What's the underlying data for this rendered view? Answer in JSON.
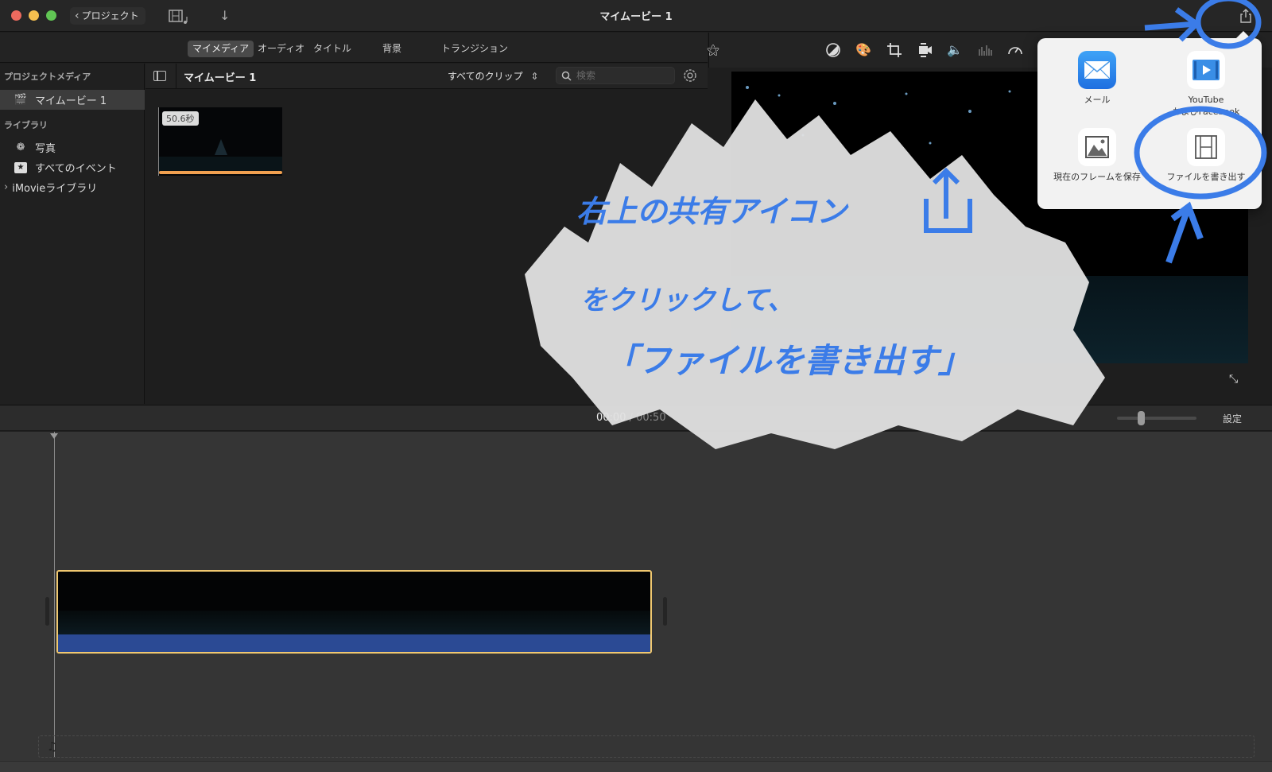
{
  "window": {
    "title": "マイムービー 1",
    "back_label": "プロジェクト"
  },
  "toolbar": {
    "media_icon": "film-music-icon",
    "import_icon": "import-arrow-icon",
    "share_icon": "share-icon"
  },
  "browser_tabs": [
    {
      "label": "マイメディア",
      "active": true
    },
    {
      "label": "オーディオ",
      "active": false
    },
    {
      "label": "タイトル",
      "active": false
    },
    {
      "label": "背景",
      "active": false
    },
    {
      "label": "トランジション",
      "active": false
    }
  ],
  "sidebar": {
    "project_media_header": "プロジェクトメディア",
    "project_item": "マイムービー 1",
    "library_header": "ライブラリ",
    "library_items": [
      {
        "label": "写真",
        "icon": "photos-icon"
      },
      {
        "label": "すべてのイベント",
        "icon": "star-icon"
      }
    ],
    "imovie_library": "iMovieライブラリ"
  },
  "browser": {
    "title": "マイムービー 1",
    "clip_filter": "すべてのクリップ",
    "search_placeholder": "検索",
    "search_value": "",
    "clips": [
      {
        "duration": "50.6秒"
      }
    ]
  },
  "viewer": {
    "tools": [
      "magic-wand-icon",
      "color-balance-icon",
      "color-correction-icon",
      "crop-icon",
      "stabilization-icon",
      "volume-icon",
      "noise-reduction-icon",
      "speed-icon"
    ]
  },
  "timeline_bar": {
    "current_time": "00:00",
    "total_time": "00:50",
    "zoom_level": 0.3,
    "settings_label": "設定"
  },
  "share_popover": {
    "options": [
      {
        "label": "メール",
        "icon": "mail-icon"
      },
      {
        "label": "YouTube\nおよびFacebook",
        "icon": "youtube-facebook-icon"
      },
      {
        "label": "現在のフレームを保存",
        "icon": "image-icon"
      },
      {
        "label": "ファイルを書き出す",
        "icon": "film-file-icon"
      }
    ]
  },
  "annotation": {
    "line1": "右上の共有アイコン",
    "line2": "をクリックして、",
    "line3": "「ファイルを書き出す」",
    "color": "#3b7ce8"
  }
}
